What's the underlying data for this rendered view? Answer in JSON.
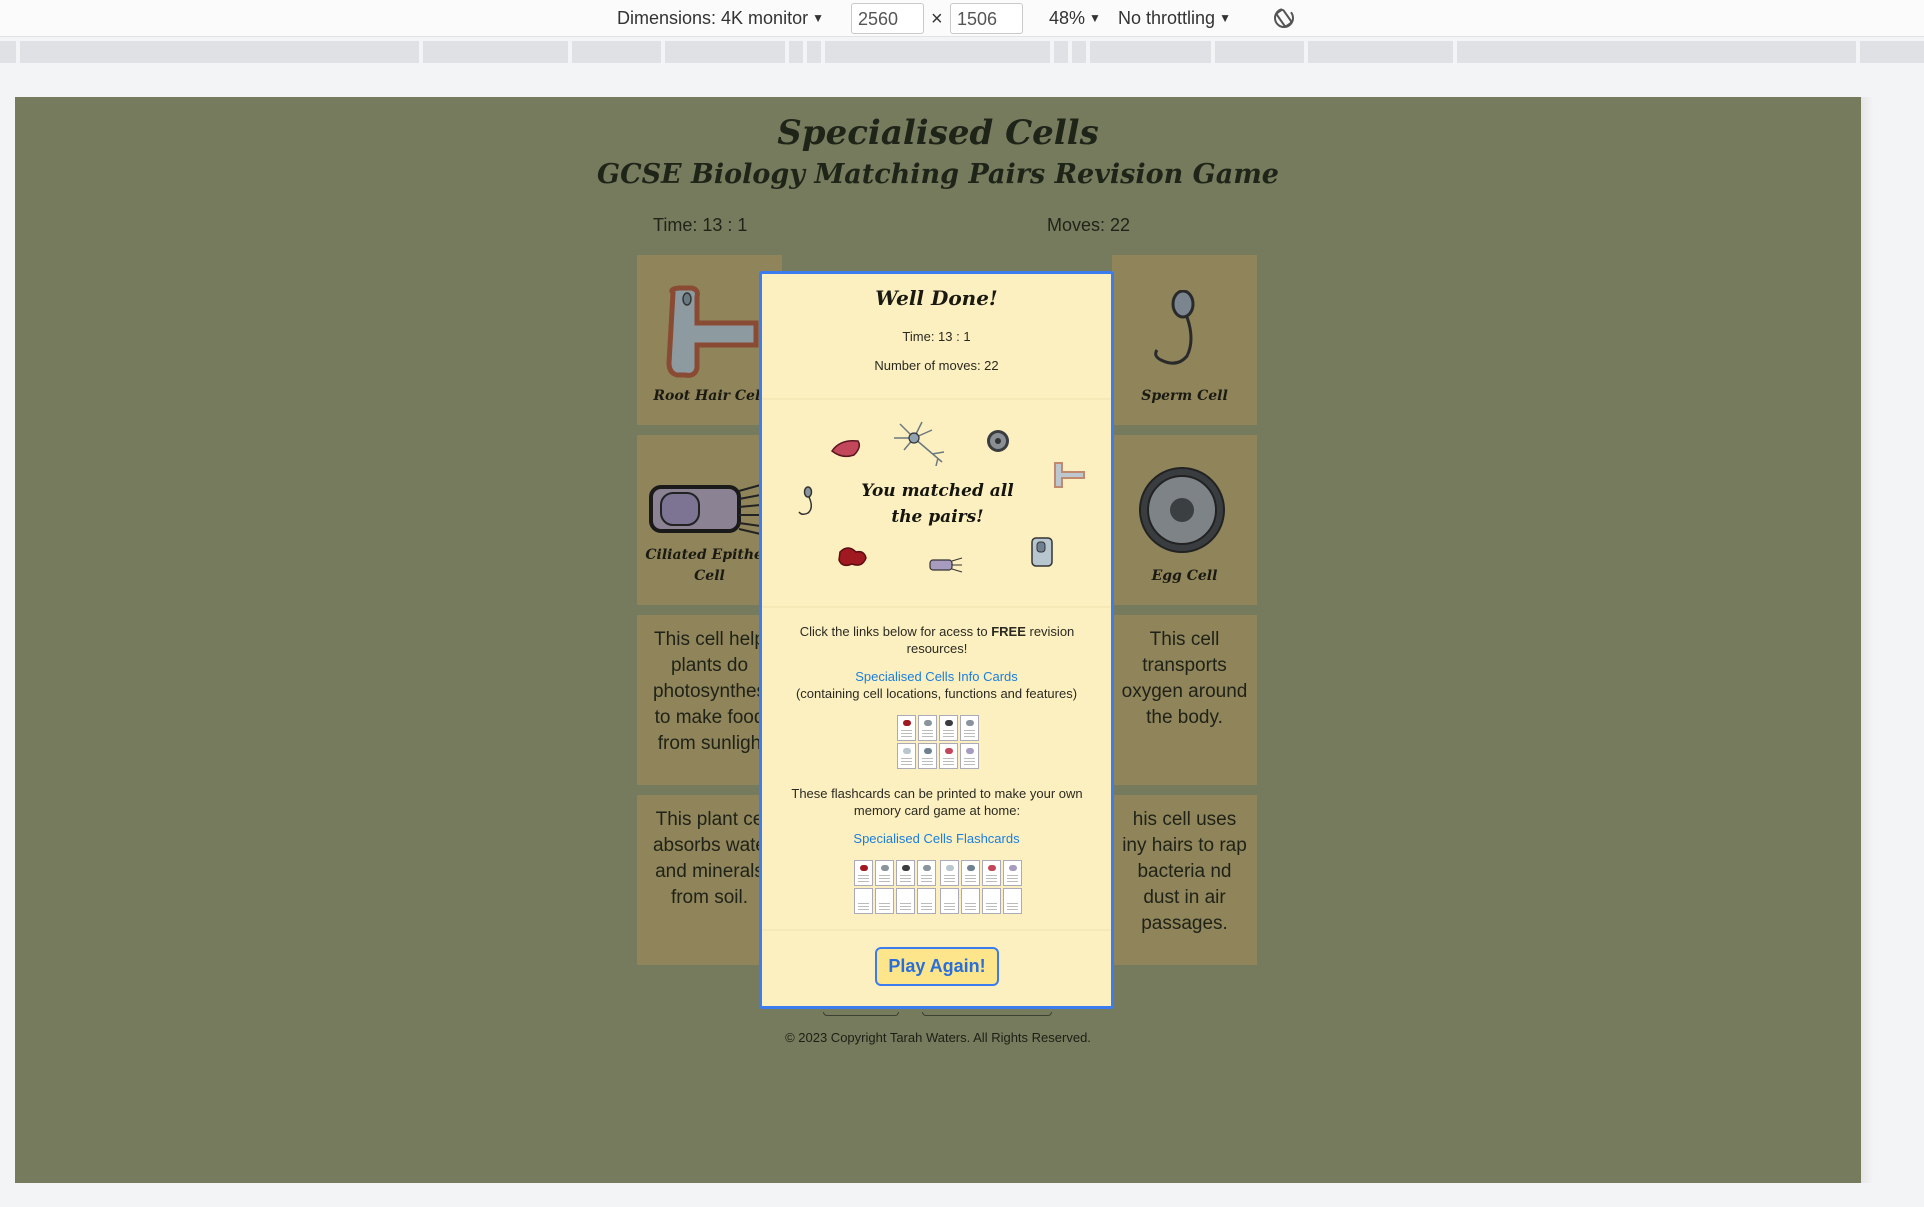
{
  "devtools": {
    "dimensions_label": "Dimensions: 4K monitor",
    "width": "2560",
    "height": "1506",
    "times": "×",
    "zoom": "48%",
    "throttling": "No throttling",
    "rotate_icon": "rotate-icon"
  },
  "page": {
    "title": "Specialised Cells",
    "subtitle": "GCSE Biology Matching Pairs Revision Game",
    "time": "Time: 13 : 1",
    "moves": "Moves: 22",
    "footer": "© 2023 Copyright Tarah Waters. All Rights Reserved."
  },
  "cards": {
    "root_hair": "Root Hair Cell",
    "sperm": "Sperm Cell",
    "ciliated": "Ciliated Epitheli Cell",
    "egg": "Egg Cell",
    "plant_text": "This cell help plants do photosynthes to make food from sunligh",
    "blood_text": "This cell transports oxygen around the body.",
    "root_text": "This plant ce absorbs wate and minerals from soil.",
    "cilia_text": "his cell uses iny hairs to rap bacteria nd dust in air passages."
  },
  "modal": {
    "title": "Well Done!",
    "time": "Time: 13 : 1",
    "moves": "Number of moves: 22",
    "matched": "You matched all the pairs!",
    "links_intro_a": "Click the links below for acess to",
    "links_intro_bold": "FREE",
    "links_intro_b": "revision resources!",
    "info_link": "Specialised Cells Info Cards",
    "info_note": "(containing cell locations, functions and features)",
    "flash_intro": "These flashcards can be printed to make your own memory card game at home:",
    "flash_link": "Specialised Cells Flashcards",
    "play_again": "Play Again!"
  },
  "colors": {
    "page_bg": "#757b5c",
    "card_bg": "#8f845a",
    "modal_bg": "#fdf0c0",
    "modal_border": "#3b7df1",
    "link": "#1a7ee0"
  }
}
